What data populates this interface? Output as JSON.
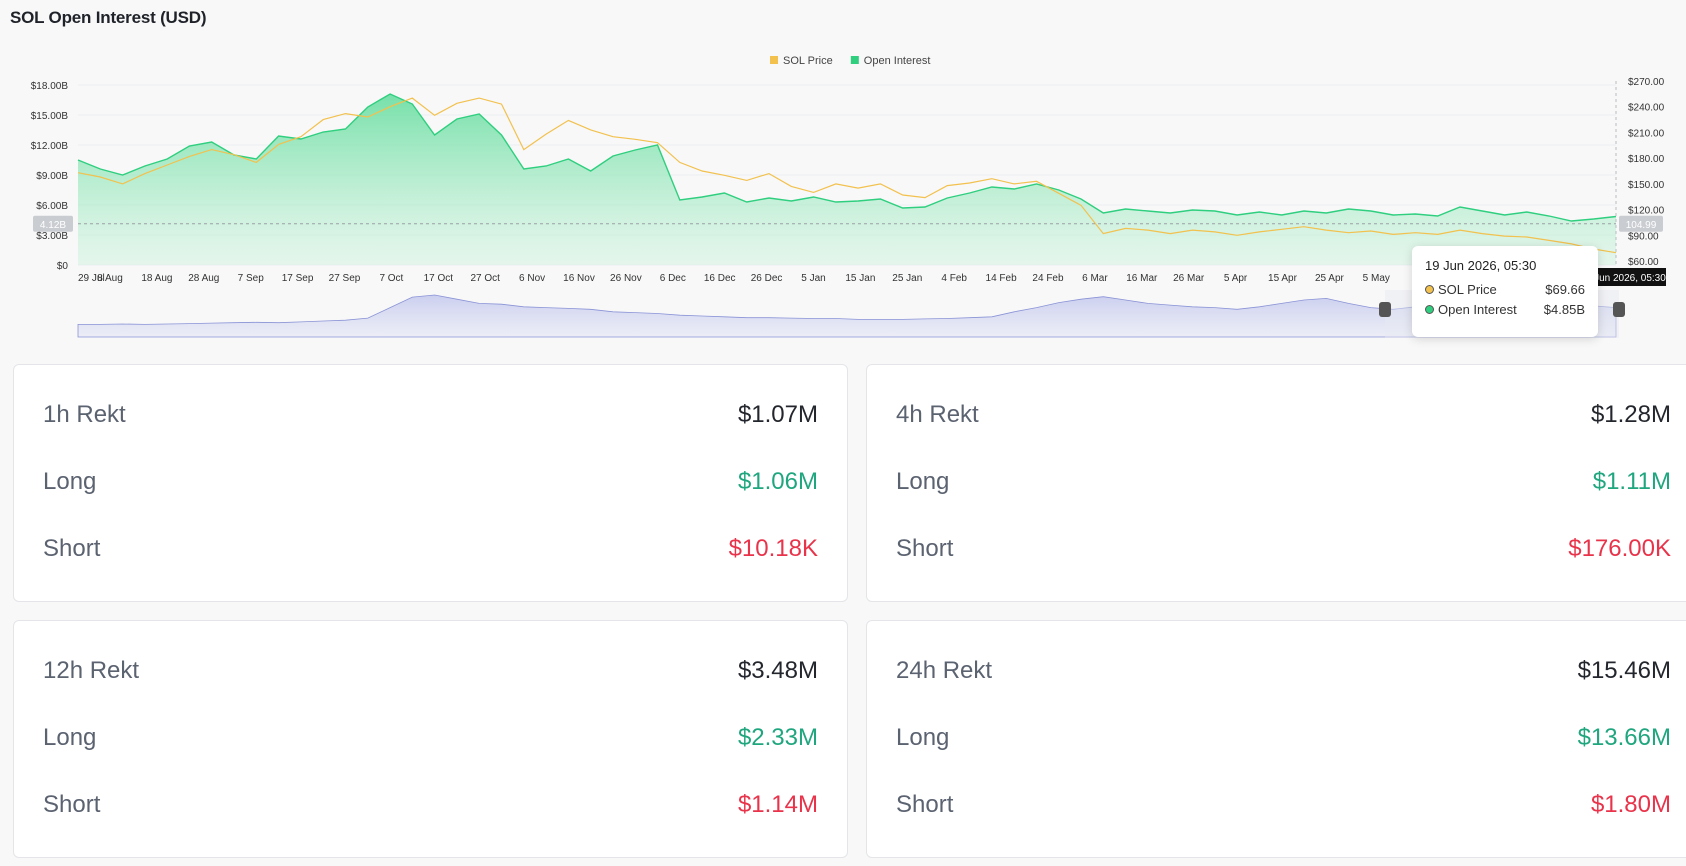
{
  "page": {
    "title": "SOL Open Interest (USD)"
  },
  "chart_data": {
    "type": "area",
    "title": "",
    "legend": {
      "position": "top-center",
      "items": [
        "SOL Price",
        "Open Interest"
      ]
    },
    "colors": {
      "price": "#f2c14e",
      "oi_line": "#2fcf7f",
      "oi_fill": "#7ee3ad",
      "navigator": "#8a93d6"
    },
    "x_labels": [
      "29 Jul",
      "8 Aug",
      "18 Aug",
      "28 Aug",
      "7 Sep",
      "17 Sep",
      "27 Sep",
      "7 Oct",
      "17 Oct",
      "27 Oct",
      "6 Nov",
      "16 Nov",
      "26 Nov",
      "6 Dec",
      "16 Dec",
      "26 Dec",
      "5 Jan",
      "15 Jan",
      "25 Jan",
      "4 Feb",
      "14 Feb",
      "24 Feb",
      "6 Mar",
      "16 Mar",
      "26 Mar",
      "5 Apr",
      "15 Apr",
      "25 Apr",
      "5 May"
    ],
    "y_left": {
      "ticks": [
        "$0",
        "$3.00B",
        "$6.00B",
        "$9.00B",
        "$12.00B",
        "$15.00B",
        "$18.00B"
      ],
      "min": 0,
      "max": 18,
      "unit": "B USD"
    },
    "y_right": {
      "ticks": [
        "$60.00",
        "$90.00",
        "$120.00",
        "$150.00",
        "$180.00",
        "$210.00",
        "$240.00",
        "$270.00"
      ],
      "min": 60,
      "max": 270
    },
    "crosshair": {
      "left_value": "4.12B",
      "right_value": "104.99",
      "x_label": "19 Jun 2026, 05:30"
    },
    "series": [
      {
        "name": "Open Interest",
        "axis": "left",
        "values": [
          10.5,
          9.6,
          9.0,
          9.9,
          10.6,
          11.9,
          12.3,
          11.0,
          10.6,
          12.9,
          12.6,
          13.3,
          13.6,
          15.8,
          17.1,
          16.1,
          13.0,
          14.6,
          15.1,
          13.0,
          9.6,
          9.9,
          10.6,
          9.4,
          10.9,
          11.5,
          12.0,
          6.5,
          6.8,
          7.2,
          6.3,
          6.7,
          6.4,
          6.8,
          6.3,
          6.4,
          6.6,
          5.7,
          5.8,
          6.7,
          7.2,
          7.8,
          7.6,
          8.1,
          7.5,
          6.6,
          5.2,
          5.6,
          5.4,
          5.2,
          5.5,
          5.4,
          5.0,
          5.3,
          5.0,
          5.4,
          5.2,
          5.6,
          5.4,
          5.0,
          5.1,
          4.9,
          5.8,
          5.4,
          5.0,
          5.3,
          4.9,
          4.4,
          4.6,
          4.85
        ]
      },
      {
        "name": "SOL Price",
        "axis": "right",
        "values": [
          163,
          158,
          150,
          162,
          172,
          182,
          190,
          184,
          175,
          196,
          205,
          225,
          232,
          228,
          240,
          250,
          230,
          244,
          250,
          243,
          190,
          208,
          224,
          213,
          205,
          202,
          198,
          175,
          165,
          160,
          154,
          162,
          147,
          140,
          150,
          145,
          150,
          137,
          134,
          148,
          151,
          156,
          150,
          153,
          139,
          125,
          92,
          98,
          96,
          92,
          96,
          94,
          90,
          94,
          97,
          100,
          96,
          93,
          95,
          91,
          93,
          91,
          96,
          92,
          89,
          88,
          84,
          80,
          74,
          69.66
        ]
      }
    ],
    "tooltip": {
      "date": "19 Jun 2026, 05:30",
      "rows": [
        {
          "name": "SOL Price",
          "value": "$69.66"
        },
        {
          "name": "Open Interest",
          "value": "$4.85B"
        }
      ]
    },
    "navigator_values": [
      0.3,
      0.3,
      0.31,
      0.3,
      0.31,
      0.32,
      0.33,
      0.34,
      0.35,
      0.34,
      0.36,
      0.38,
      0.4,
      0.45,
      0.7,
      0.95,
      1.0,
      0.9,
      0.8,
      0.78,
      0.72,
      0.7,
      0.68,
      0.66,
      0.6,
      0.58,
      0.56,
      0.52,
      0.5,
      0.48,
      0.46,
      0.46,
      0.45,
      0.44,
      0.44,
      0.42,
      0.42,
      0.42,
      0.43,
      0.44,
      0.46,
      0.48,
      0.6,
      0.7,
      0.82,
      0.9,
      0.96,
      0.88,
      0.8,
      0.76,
      0.72,
      0.7,
      0.66,
      0.72,
      0.8,
      0.88,
      0.92,
      0.8,
      0.7,
      0.66,
      0.72,
      0.8,
      0.86,
      0.9,
      0.82,
      0.76,
      0.8,
      0.78,
      0.74,
      0.7
    ]
  },
  "cards": [
    {
      "header": {
        "label": "1h Rekt",
        "value": "$1.07M"
      },
      "long": {
        "label": "Long",
        "value": "$1.06M"
      },
      "short": {
        "label": "Short",
        "value": "$10.18K"
      }
    },
    {
      "header": {
        "label": "4h Rekt",
        "value": "$1.28M"
      },
      "long": {
        "label": "Long",
        "value": "$1.11M"
      },
      "short": {
        "label": "Short",
        "value": "$176.00K"
      }
    },
    {
      "header": {
        "label": "12h Rekt",
        "value": "$3.48M"
      },
      "long": {
        "label": "Long",
        "value": "$2.33M"
      },
      "short": {
        "label": "Short",
        "value": "$1.14M"
      }
    },
    {
      "header": {
        "label": "24h Rekt",
        "value": "$15.46M"
      },
      "long": {
        "label": "Long",
        "value": "$13.66M"
      },
      "short": {
        "label": "Short",
        "value": "$1.80M"
      }
    }
  ]
}
